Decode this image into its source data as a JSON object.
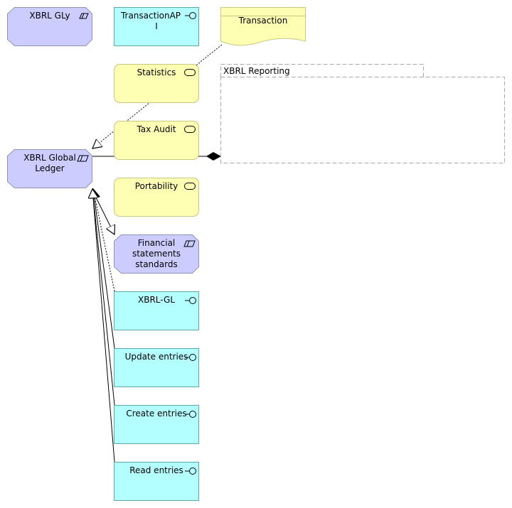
{
  "diagram": {
    "colors": {
      "business_object": "#ccccff",
      "business_object_stroke": "#9090c0",
      "app_interface": "#b3ffff",
      "app_interface_stroke": "#5fa8a8",
      "service": "#ffffb3",
      "service_stroke": "#c8c880",
      "group_stroke": "#aaaaaa"
    },
    "nodes": [
      {
        "id": "xbrl-gly",
        "type": "data-object",
        "label_lines": [
          "XBRL GLy"
        ],
        "icon": "data-object-icon"
      },
      {
        "id": "transaction-api",
        "type": "application-interface",
        "label_lines": [
          "TransactionAP",
          "I"
        ],
        "icon": "interface-icon"
      },
      {
        "id": "transaction",
        "type": "representation",
        "label_lines": [
          "Transaction"
        ]
      },
      {
        "id": "statistics",
        "type": "business-service",
        "label_lines": [
          "Statistics"
        ],
        "icon": "service-icon"
      },
      {
        "id": "xbrl-reporting",
        "type": "group",
        "label_lines": [
          "XBRL Reporting"
        ]
      },
      {
        "id": "tax-audit",
        "type": "business-service",
        "label_lines": [
          "Tax Audit"
        ],
        "icon": "service-icon"
      },
      {
        "id": "xbrl-global-ledger",
        "type": "data-object",
        "label_lines": [
          "XBRL Global",
          "Ledger"
        ],
        "icon": "data-object-icon"
      },
      {
        "id": "portability",
        "type": "business-service",
        "label_lines": [
          "Portability"
        ],
        "icon": "service-icon"
      },
      {
        "id": "financial-statements-standards",
        "type": "data-object",
        "label_lines": [
          "Financial",
          "statements",
          "standards"
        ],
        "icon": "data-object-icon"
      },
      {
        "id": "xbrl-gl",
        "type": "application-interface",
        "label_lines": [
          "XBRL-GL"
        ],
        "icon": "interface-icon"
      },
      {
        "id": "update-entries",
        "type": "application-interface",
        "label_lines": [
          "Update entries"
        ],
        "icon": "interface-icon"
      },
      {
        "id": "create-entries",
        "type": "application-interface",
        "label_lines": [
          "Create entries"
        ],
        "icon": "interface-icon"
      },
      {
        "id": "read-entries",
        "type": "application-interface",
        "label_lines": [
          "Read entries"
        ],
        "icon": "interface-icon"
      }
    ],
    "edges": [
      {
        "from": "transaction",
        "to": "xbrl-global-ledger",
        "type": "realization",
        "style": "dotted",
        "head": "hollow-triangle"
      },
      {
        "from": "xbrl-global-ledger",
        "to": "xbrl-reporting",
        "type": "composition",
        "style": "solid",
        "head": "filled-diamond"
      },
      {
        "from": "xbrl-global-ledger",
        "to": "financial-statements-standards",
        "type": "specialization",
        "style": "solid",
        "head": "hollow-triangle"
      },
      {
        "from": "xbrl-gl",
        "to": "xbrl-global-ledger",
        "type": "realization",
        "style": "dotted",
        "head": "hollow-triangle"
      },
      {
        "from": "update-entries",
        "to": "xbrl-global-ledger",
        "type": "access",
        "style": "solid",
        "head": "hollow-triangle"
      },
      {
        "from": "create-entries",
        "to": "xbrl-global-ledger",
        "type": "access",
        "style": "solid",
        "head": "hollow-triangle"
      },
      {
        "from": "read-entries",
        "to": "xbrl-global-ledger",
        "type": "access",
        "style": "solid",
        "head": "hollow-triangle"
      }
    ]
  }
}
